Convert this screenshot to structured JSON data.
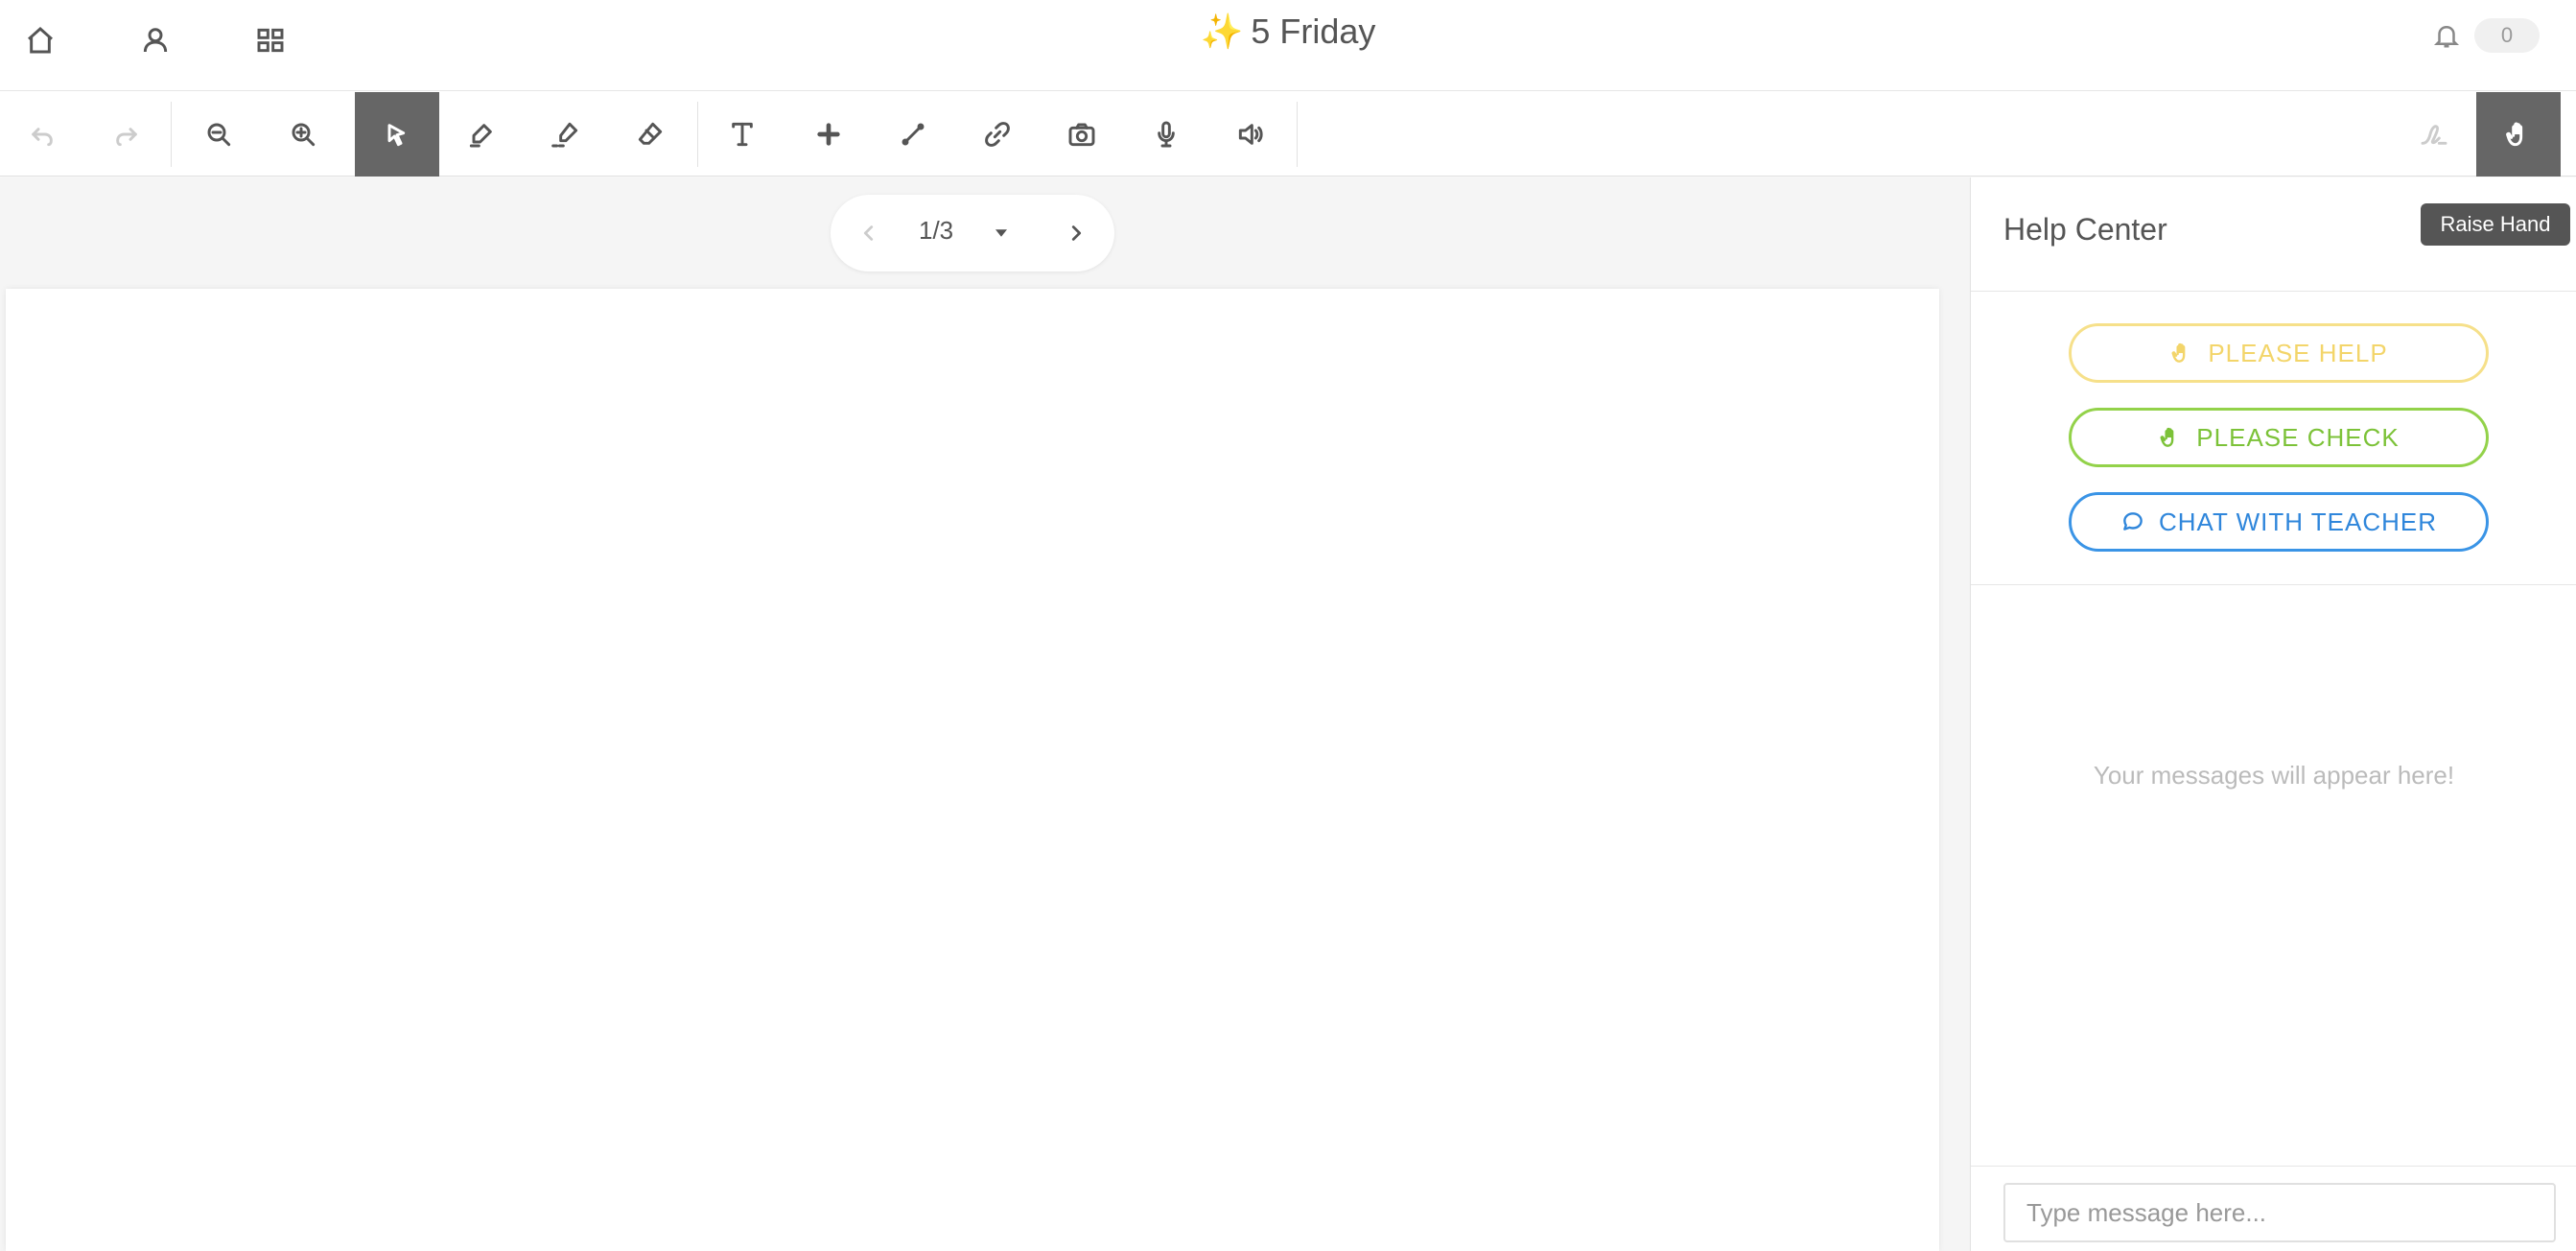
{
  "header": {
    "title_emoji": "✨",
    "title": "5 Friday",
    "home_icon": "home-icon",
    "profile_icon": "user-icon",
    "apps_icon": "grid-icon",
    "notification_icon": "bell-icon",
    "notification_count": "0"
  },
  "toolbar": {
    "tools": [
      {
        "name": "undo-icon",
        "state": "disabled"
      },
      {
        "name": "redo-icon",
        "state": "disabled"
      },
      {
        "name": "zoom-out-icon",
        "state": "normal"
      },
      {
        "name": "zoom-in-icon",
        "state": "normal"
      },
      {
        "name": "select-cursor-icon",
        "state": "active"
      },
      {
        "name": "pen-icon",
        "state": "normal"
      },
      {
        "name": "highlighter-icon",
        "state": "normal"
      },
      {
        "name": "eraser-icon",
        "state": "normal"
      },
      {
        "name": "text-icon",
        "state": "normal"
      },
      {
        "name": "plus-icon",
        "state": "normal"
      },
      {
        "name": "line-icon",
        "state": "normal"
      },
      {
        "name": "link-icon",
        "state": "normal"
      },
      {
        "name": "camera-icon",
        "state": "normal"
      },
      {
        "name": "microphone-icon",
        "state": "normal"
      },
      {
        "name": "speaker-icon",
        "state": "normal"
      },
      {
        "name": "signature-icon",
        "state": "disabled"
      },
      {
        "name": "raise-hand-icon",
        "state": "active"
      }
    ],
    "active_color": "#666666"
  },
  "pager": {
    "label": "1/3",
    "current": 1,
    "total": 3
  },
  "help_center": {
    "title": "Help Center",
    "please_help": "PLEASE HELP",
    "please_check": "PLEASE CHECK",
    "chat_with_teacher": "CHAT WITH TEACHER",
    "empty_message": "Your messages will appear here!",
    "input_placeholder": "Type message here...",
    "colors": {
      "help": "#f3d56a",
      "check": "#7cc238",
      "chat": "#2f86db"
    }
  },
  "tooltip": {
    "raise_hand": "Raise Hand"
  }
}
